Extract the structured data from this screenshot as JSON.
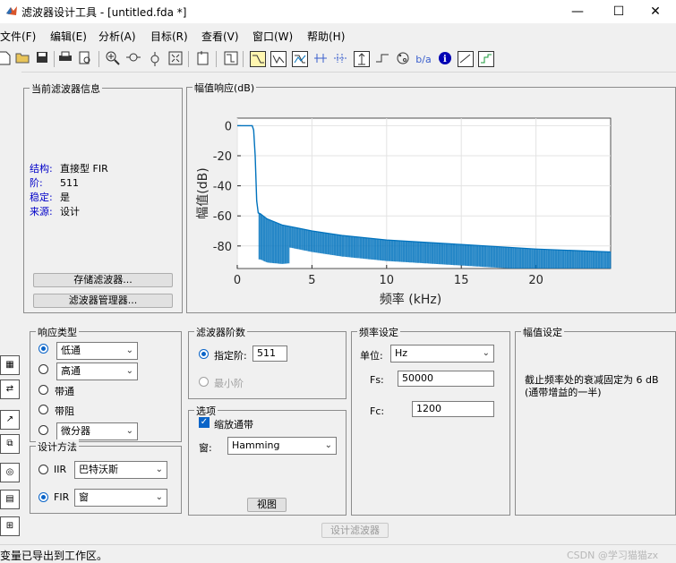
{
  "window": {
    "title": "滤波器设计工具 - [untitled.fda *]",
    "minimize": "—",
    "maximize": "☐",
    "close": "✕"
  },
  "menu": [
    "文件(F)",
    "编辑(E)",
    "分析(A)",
    "目标(R)",
    "查看(V)",
    "窗口(W)",
    "帮助(H)"
  ],
  "info_panel": {
    "title": "当前滤波器信息",
    "rows": [
      {
        "label": "结构:",
        "value": "直接型 FIR"
      },
      {
        "label": "阶:",
        "value": "511"
      },
      {
        "label": "稳定:",
        "value": "是"
      },
      {
        "label": "来源:",
        "value": "设计"
      }
    ],
    "store_button": "存储滤波器...",
    "manager_button": "滤波器管理器..."
  },
  "plot_panel": {
    "title": "幅值响应(dB)"
  },
  "chart_data": {
    "type": "line",
    "xlabel": "频率 (kHz)",
    "ylabel": "幅值(dB)",
    "xlim": [
      0,
      25
    ],
    "ylim": [
      -95,
      5
    ],
    "xticks": [
      0,
      5,
      10,
      15,
      20
    ],
    "yticks": [
      0,
      -20,
      -40,
      -60,
      -80
    ],
    "grid": true,
    "cutoff_khz": 1.2,
    "series": [
      {
        "color": "#0072bd",
        "x": [
          0,
          0.5,
          1.0,
          1.1,
          1.2,
          1.3,
          1.4,
          1.6,
          2,
          3,
          4,
          5,
          7,
          10,
          15,
          20,
          25
        ],
        "y": [
          0,
          0,
          0,
          -3,
          -20,
          -50,
          -58,
          -59,
          -62,
          -66,
          -68,
          -70,
          -73,
          -76,
          -79,
          -82,
          -84
        ]
      }
    ],
    "stopband_floor_db": -95
  },
  "response_type": {
    "title": "响应类型",
    "options": [
      {
        "label": "低通",
        "selected": true,
        "dropdown": "低通"
      },
      {
        "label": "高通",
        "selected": false,
        "dropdown": "高通"
      },
      {
        "label": "带通",
        "selected": false
      },
      {
        "label": "带阻",
        "selected": false
      },
      {
        "label": "",
        "selected": false,
        "dropdown": "微分器"
      }
    ]
  },
  "design_method": {
    "title": "设计方法",
    "iir_label": "IIR",
    "iir_value": "巴特沃斯",
    "fir_label": "FIR",
    "fir_value": "窗",
    "fir_selected": true
  },
  "order_panel": {
    "title": "滤波器阶数",
    "specify_label": "指定阶:",
    "specify_value": "511",
    "min_label": "最小阶"
  },
  "options_panel": {
    "title": "选项",
    "scale_label": "缩放通带",
    "window_label": "窗:",
    "window_value": "Hamming",
    "view_button": "视图"
  },
  "freq_panel": {
    "title": "频率设定",
    "units_label": "单位:",
    "units_value": "Hz",
    "fs_label": "Fs:",
    "fs_value": "50000",
    "fc_label": "Fc:",
    "fc_value": "1200"
  },
  "mag_panel": {
    "title": "幅值设定",
    "text": "截止频率处的衰减固定为 6 dB (通带增益的一半)"
  },
  "design_button": "设计滤波器",
  "status": "变量已导出到工作区。",
  "watermark": "CSDN @学习猫猫zx"
}
